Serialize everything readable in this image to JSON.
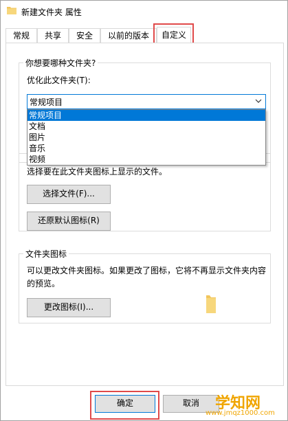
{
  "window": {
    "title": "新建文件夹 属性"
  },
  "tabs": [
    {
      "label": "常规"
    },
    {
      "label": "共享"
    },
    {
      "label": "安全"
    },
    {
      "label": "以前的版本"
    },
    {
      "label": "自定义",
      "active": true
    }
  ],
  "folder_type_group": {
    "title": "你想要哪种文件夹?",
    "optimize_label": "优化此文件夹(T):",
    "selected_value": "常规项目",
    "options": [
      "常规项目",
      "文档",
      "图片",
      "音乐",
      "视频"
    ]
  },
  "folder_picture_group": {
    "description": "选择要在此文件夹图标上显示的文件。",
    "choose_file_button": "选择文件(F)...",
    "restore_default_button": "还原默认图标(R)"
  },
  "folder_icon_group": {
    "title": "文件夹图标",
    "description": "可以更改文件夹图标。如果更改了图标，它将不再显示文件夹内容的预览。",
    "change_icon_button": "更改图标(I)..."
  },
  "footer": {
    "ok_button": "确定",
    "cancel_button": "取消"
  },
  "watermark": {
    "main": "学知网",
    "url": "www.jmqz1000.com"
  },
  "colors": {
    "accent": "#0078d7",
    "highlight_box": "#e04949",
    "folder": "#f2c55c",
    "watermark": "#f0a500"
  },
  "icons": {
    "title": "folder-icon",
    "combo": "chevron-down-icon",
    "preview": "folder-icon"
  }
}
